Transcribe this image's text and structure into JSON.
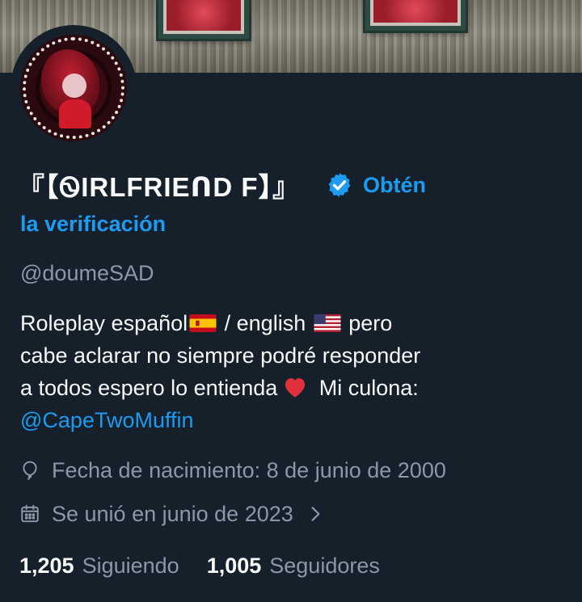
{
  "profile": {
    "display_name": "『【ᏫIRLFRIEᑎD F】』",
    "verify_link_1": "Obtén",
    "verify_link_2": "la verificación",
    "handle": "@doumeSAD",
    "bio": {
      "line1_a": "Roleplay español",
      "line1_b": " / english ",
      "line1_c": " pero",
      "line2": "cabe aclarar  no siempre podré responder",
      "line3_a": "a todos espero lo entienda",
      "line3_b": " Mi culona:",
      "mention": "@CapeTwoMuffin"
    },
    "birth": "Fecha de nacimiento: 8 de junio de 2000",
    "joined": "Se unió en junio de 2023",
    "following_count": "1,205",
    "following_label": "Siguiendo",
    "followers_count": "1,005",
    "followers_label": "Seguidores"
  },
  "icons": {
    "verify": "verified-badge-icon",
    "birth": "balloon-icon",
    "joined": "calendar-icon",
    "chevron": "chevron-right-icon"
  },
  "colors": {
    "background": "#15202b",
    "text": "#f7f9f9",
    "secondary": "#8b98a5",
    "accent": "#1d9bf0"
  }
}
